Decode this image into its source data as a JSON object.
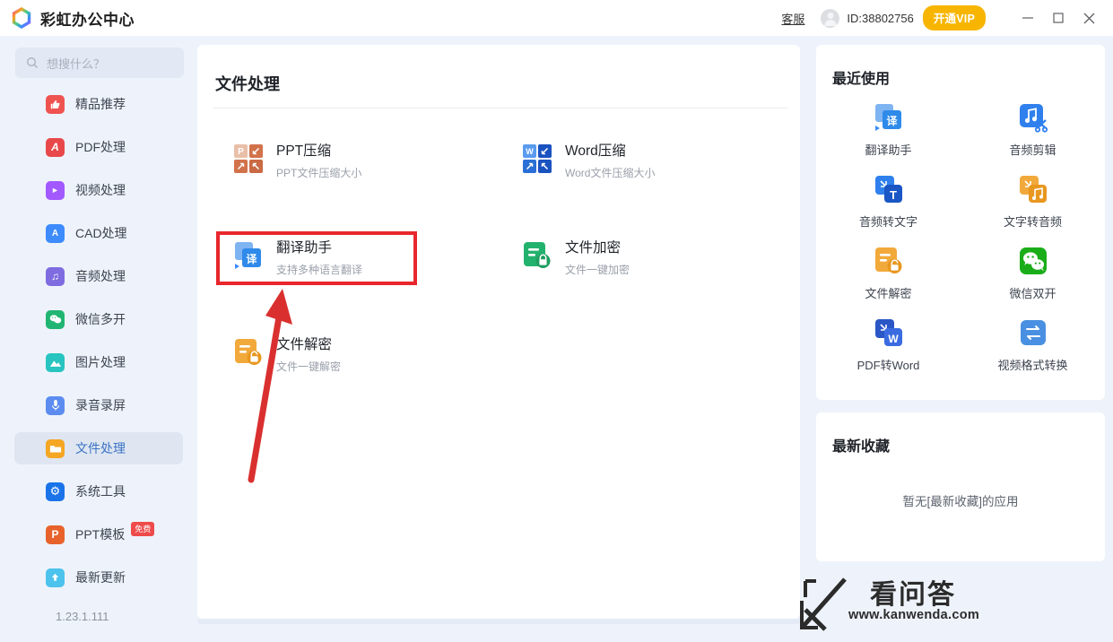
{
  "window": {
    "app_title": "彩虹办公中心",
    "logo_icon": "rainbow-hexagon-logo",
    "support_link": "客服",
    "user_id": "ID:38802756",
    "vip_button": "开通VIP",
    "minimize_icon": "minimize-icon",
    "maximize_icon": "maximize-icon",
    "close_icon": "close-icon",
    "avatar_icon": "user-avatar-icon"
  },
  "sidebar": {
    "search": {
      "placeholder": "想搜什么？",
      "icon": "search-icon"
    },
    "version": "1.23.1.111",
    "items": [
      {
        "label": "精品推荐",
        "icon": "thumb-up-icon",
        "color": "#ef5350",
        "glyph": "☝",
        "active": false
      },
      {
        "label": "PDF处理",
        "icon": "pdf-icon",
        "color": "#e8484a",
        "glyph": "A",
        "active": false
      },
      {
        "label": "视频处理",
        "icon": "video-icon",
        "color": "#a259ff",
        "glyph": "▶",
        "active": false
      },
      {
        "label": "CAD处理",
        "icon": "cad-icon",
        "color": "#3d8bfd",
        "glyph": "A",
        "active": false
      },
      {
        "label": "音频处理",
        "icon": "audio-icon",
        "color": "#7e6ce0",
        "glyph": "♫",
        "active": false
      },
      {
        "label": "微信多开",
        "icon": "wechat-icon",
        "color": "#21b573",
        "glyph": "●",
        "active": false
      },
      {
        "label": "图片处理",
        "icon": "image-icon",
        "color": "#27c4c0",
        "glyph": "▲",
        "active": false
      },
      {
        "label": "录音录屏",
        "icon": "microphone-icon",
        "color": "#5c8cf0",
        "glyph": "☸",
        "active": false
      },
      {
        "label": "文件处理",
        "icon": "folder-icon",
        "color": "#f5a623",
        "glyph": "▬",
        "active": true
      },
      {
        "label": "系统工具",
        "icon": "gear-icon",
        "color": "#1a73e8",
        "glyph": "⚙",
        "active": false
      },
      {
        "label": "PPT模板",
        "icon": "ppt-icon",
        "color": "#e8632c",
        "glyph": "P",
        "active": false,
        "badge": "免费"
      },
      {
        "label": "最新更新",
        "icon": "upload-arrow-icon",
        "color": "#4cc3ec",
        "glyph": "↑",
        "active": false
      }
    ]
  },
  "main": {
    "section_title": "文件处理",
    "tools": [
      {
        "name": "PPT压缩",
        "desc": "PPT文件压缩大小",
        "icon": "ppt-compress-icon",
        "color": "#d2724b",
        "letter": "P",
        "highlighted": false
      },
      {
        "name": "Word压缩",
        "desc": "Word文件压缩大小",
        "icon": "word-compress-icon",
        "color": "#2a6fd6",
        "letter": "W",
        "highlighted": false
      },
      {
        "name": "翻译助手",
        "desc": "支持多种语言翻译",
        "icon": "translate-icon",
        "color": "#2f8aea",
        "letter": "译",
        "highlighted": true
      },
      {
        "name": "文件加密",
        "desc": "文件一键加密",
        "icon": "file-lock-icon",
        "color": "#23b26d",
        "letter": "",
        "highlighted": false
      },
      {
        "name": "文件解密",
        "desc": "文件一键解密",
        "icon": "file-unlock-icon",
        "color": "#f2a93b",
        "letter": "",
        "highlighted": false
      }
    ],
    "annotation": {
      "box_color": "#e8272c",
      "arrow_color": "#d9302f",
      "target": "翻译助手"
    }
  },
  "right": {
    "recent_title": "最近使用",
    "recent_items": [
      {
        "label": "翻译助手",
        "icon": "translate-icon",
        "color": "#2f8aea"
      },
      {
        "label": "音频剪辑",
        "icon": "audio-cut-icon",
        "color": "#1a73e8"
      },
      {
        "label": "音频转文字",
        "icon": "audio-to-text-icon",
        "color": "#1a73e8"
      },
      {
        "label": "文字转音频",
        "icon": "text-to-audio-icon",
        "color": "#f2a93b"
      },
      {
        "label": "文件解密",
        "icon": "file-unlock-icon",
        "color": "#f2a93b"
      },
      {
        "label": "微信双开",
        "icon": "wechat-icon",
        "color": "#1aad19"
      },
      {
        "label": "PDF转Word",
        "icon": "pdf-to-word-icon",
        "color": "#2a56c6"
      },
      {
        "label": "视频格式转换",
        "icon": "video-convert-icon",
        "color": "#4a90e2"
      }
    ],
    "fav_title": "最新收藏",
    "fav_empty": "暂无[最新收藏]的应用"
  },
  "watermark": {
    "brand": "看问答",
    "url": "www.kanwenda.com"
  }
}
